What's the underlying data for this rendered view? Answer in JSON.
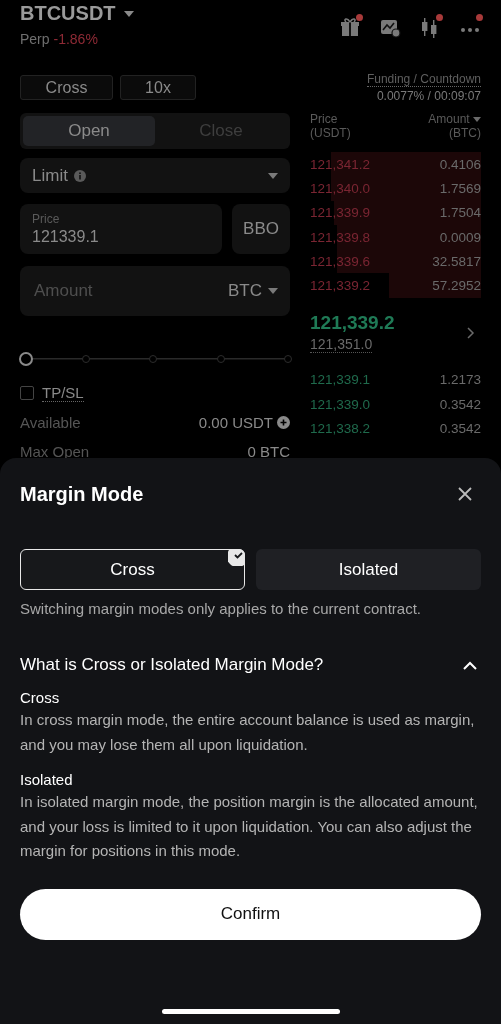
{
  "header": {
    "symbol": "BTCUSDT",
    "type": "Perp",
    "change": "-1.86%"
  },
  "toolbar_icons": [
    {
      "kind": "gift",
      "badge": true
    },
    {
      "kind": "chart",
      "badge": false
    },
    {
      "kind": "candles",
      "badge": true
    },
    {
      "kind": "more",
      "badge": true
    }
  ],
  "order_panel": {
    "margin_button": "Cross",
    "leverage_button": "10x",
    "tabs": [
      {
        "label": "Open",
        "selected": true
      },
      {
        "label": "Close",
        "selected": false
      }
    ],
    "order_type": "Limit",
    "price_label": "Price",
    "price_value": "121339.1",
    "bbo_button": "BBO",
    "amount_placeholder": "Amount",
    "amount_unit": "BTC",
    "slider": {
      "level": 0
    },
    "tpsl": {
      "label": "TP/SL",
      "checked": false
    },
    "info": [
      {
        "label": "Available",
        "value": "0.00 USDT"
      },
      {
        "label": "Max Open",
        "value": "0 BTC"
      }
    ]
  },
  "funding": {
    "label": "Funding / Countdown",
    "value": "0.0077% / 00:09:07"
  },
  "order_book": {
    "columns": [
      {
        "line1": "Price",
        "line2": "(USDT)"
      },
      {
        "line1": "Amount",
        "line2": "(BTC)"
      }
    ],
    "asks": [
      {
        "price": "121,341.2",
        "amount": "0.4106"
      },
      {
        "price": "121,340.0",
        "amount": "1.7569"
      },
      {
        "price": "121,339.9",
        "amount": "1.7504"
      },
      {
        "price": "121,339.8",
        "amount": "0.0009"
      },
      {
        "price": "121,339.6",
        "amount": "32.5817"
      },
      {
        "price": "121,339.2",
        "amount": "57.2952"
      }
    ],
    "last_price": "121,339.2",
    "mark_price": "121,351.0",
    "bids": [
      {
        "price": "121,339.1",
        "amount": "1.2173"
      },
      {
        "price": "121,339.0",
        "amount": "0.3542"
      },
      {
        "price": "121,338.2",
        "amount": "0.3542"
      }
    ]
  },
  "sheet": {
    "title": "Margin Mode",
    "modes": [
      {
        "label": "Cross",
        "selected": true
      },
      {
        "label": "Isolated",
        "selected": false
      }
    ],
    "note": "Switching margin modes only applies to the current contract.",
    "faq": {
      "question": "What is Cross or Isolated Margin Mode?",
      "expanded": true,
      "items": [
        {
          "term": "Cross",
          "text": "In cross margin mode, the entire account balance is used as margin, and you may lose them all upon liquidation."
        },
        {
          "term": "Isolated",
          "text": "In isolated margin mode, the position margin is the allocated amount, and your loss is limited to it upon liquidation. You can also adjust the margin for positions in this mode."
        }
      ]
    },
    "confirm_button": "Confirm"
  }
}
